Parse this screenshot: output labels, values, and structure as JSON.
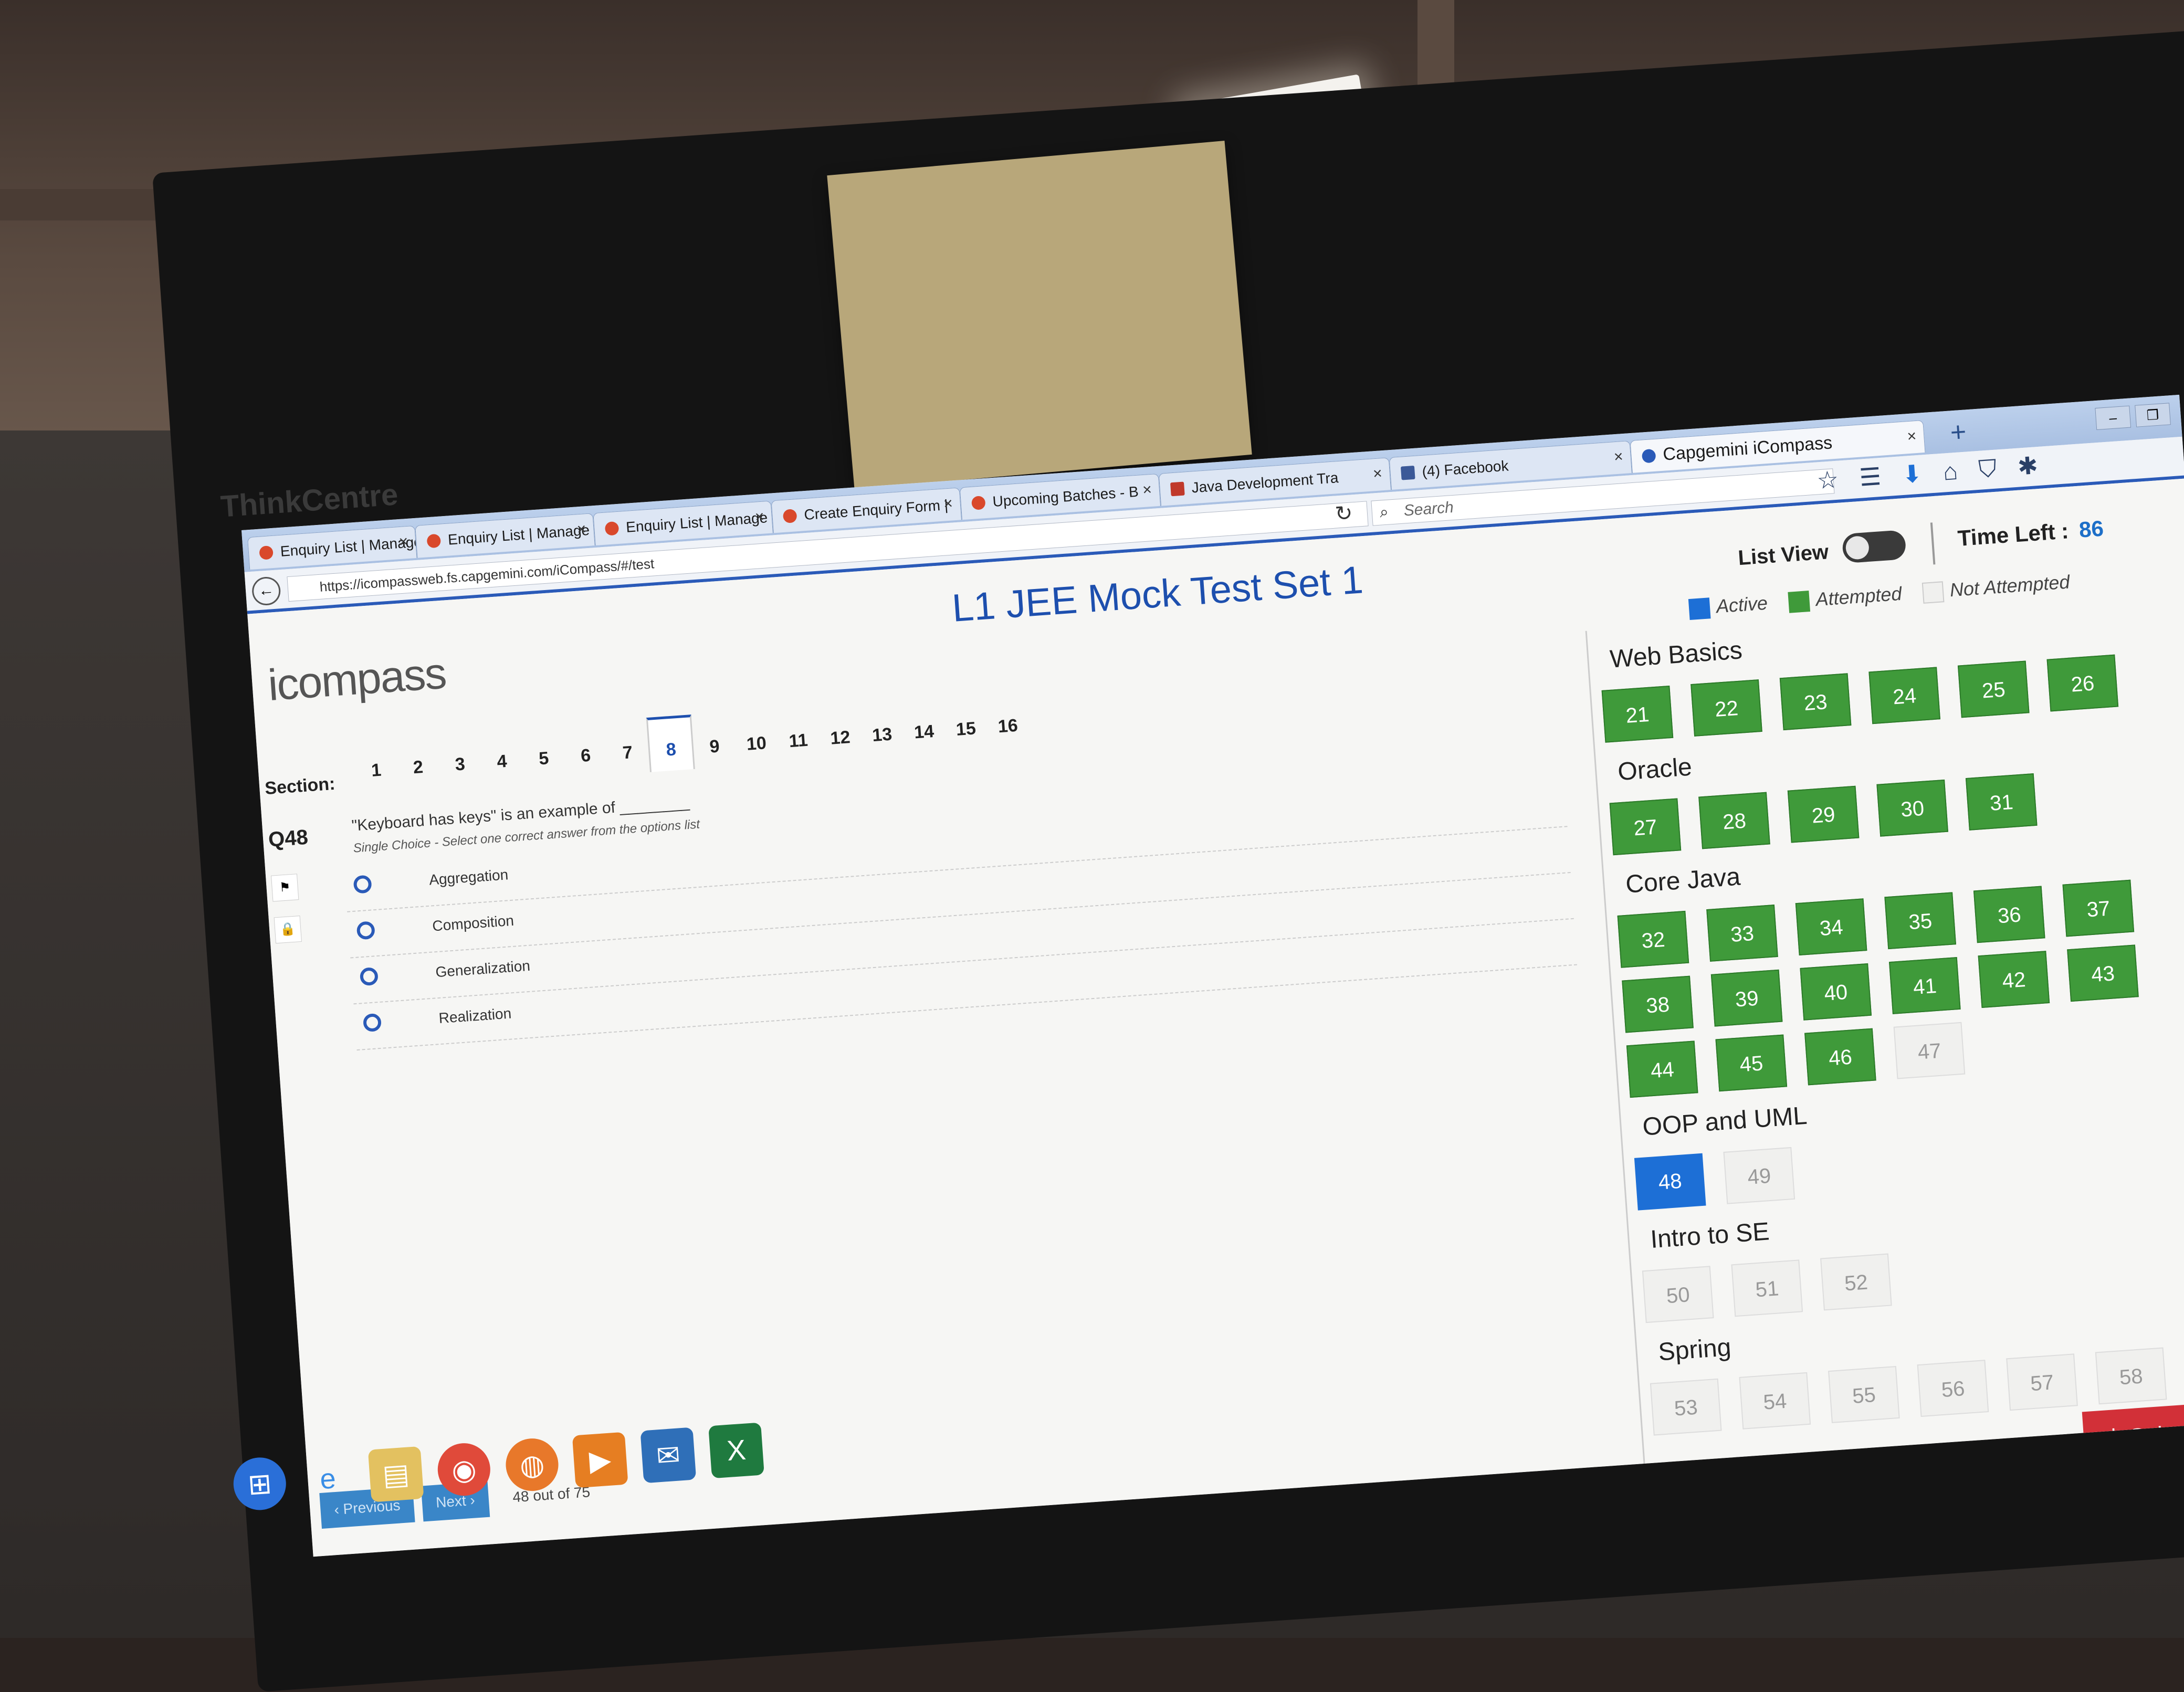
{
  "monitor": {
    "brand": "ThinkCentre"
  },
  "browser": {
    "tabs": [
      {
        "label": "Enquiry List | Manage"
      },
      {
        "label": "Enquiry List | Manage"
      },
      {
        "label": "Enquiry List | Manage"
      },
      {
        "label": "Create Enquiry Form |"
      },
      {
        "label": "Upcoming Batches - B"
      },
      {
        "label": "Java Development Tra"
      },
      {
        "label": "(4) Facebook"
      },
      {
        "label": "Capgemini iCompass"
      }
    ],
    "new_tab": "+",
    "url": "https://icompassweb.fs.capgemini.com/iCompass/#/test",
    "search_placeholder": "Search"
  },
  "page": {
    "logo": "icompass",
    "title": "L1 JEE Mock Test Set 1",
    "list_view_label": "List View",
    "time_left_label": "Time Left :",
    "time_left_value": "86",
    "legend": {
      "active": "Active",
      "attempted": "Attempted",
      "not_attempted": "Not Attempted"
    },
    "section_label": "Section:",
    "sections": [
      "1",
      "2",
      "3",
      "4",
      "5",
      "6",
      "7",
      "8",
      "9",
      "10",
      "11",
      "12",
      "13",
      "14",
      "15",
      "16"
    ],
    "current_section": "8",
    "question": {
      "number": "Q48",
      "text": "\"Keyboard has keys\" is an example of ________",
      "hint": "Single Choice - Select one correct answer from the options list",
      "options": [
        "Aggregation",
        "Composition",
        "Generalization",
        "Realization"
      ]
    },
    "footer": {
      "previous": "‹ Previous",
      "next": "Next ›",
      "count": "48 out of 75"
    },
    "submit": "Submit Asses"
  },
  "palette": [
    {
      "title": "Web Basics",
      "questions": [
        {
          "n": "21",
          "s": "attempted"
        },
        {
          "n": "22",
          "s": "attempted"
        },
        {
          "n": "23",
          "s": "attempted"
        },
        {
          "n": "24",
          "s": "attempted"
        },
        {
          "n": "25",
          "s": "attempted"
        },
        {
          "n": "26",
          "s": "attempted"
        }
      ]
    },
    {
      "title": "Oracle",
      "questions": [
        {
          "n": "27",
          "s": "attempted"
        },
        {
          "n": "28",
          "s": "attempted"
        },
        {
          "n": "29",
          "s": "attempted"
        },
        {
          "n": "30",
          "s": "attempted"
        },
        {
          "n": "31",
          "s": "attempted"
        }
      ]
    },
    {
      "title": "Core Java",
      "questions": [
        {
          "n": "32",
          "s": "attempted"
        },
        {
          "n": "33",
          "s": "attempted"
        },
        {
          "n": "34",
          "s": "attempted"
        },
        {
          "n": "35",
          "s": "attempted"
        },
        {
          "n": "36",
          "s": "attempted"
        },
        {
          "n": "37",
          "s": "attempted"
        },
        {
          "n": "38",
          "s": "attempted"
        },
        {
          "n": "39",
          "s": "attempted"
        },
        {
          "n": "40",
          "s": "attempted"
        },
        {
          "n": "41",
          "s": "attempted"
        },
        {
          "n": "42",
          "s": "attempted"
        },
        {
          "n": "43",
          "s": "attempted"
        },
        {
          "n": "44",
          "s": "attempted"
        },
        {
          "n": "45",
          "s": "attempted"
        },
        {
          "n": "46",
          "s": "attempted"
        },
        {
          "n": "47",
          "s": "not_attempted"
        }
      ]
    },
    {
      "title": "OOP and UML",
      "questions": [
        {
          "n": "48",
          "s": "active"
        },
        {
          "n": "49",
          "s": "not_attempted"
        }
      ]
    },
    {
      "title": "Intro to SE",
      "questions": [
        {
          "n": "50",
          "s": "not_attempted"
        },
        {
          "n": "51",
          "s": "not_attempted"
        },
        {
          "n": "52",
          "s": "not_attempted"
        }
      ]
    },
    {
      "title": "Spring",
      "questions": [
        {
          "n": "53",
          "s": "not_attempted"
        },
        {
          "n": "54",
          "s": "not_attempted"
        },
        {
          "n": "55",
          "s": "not_attempted"
        },
        {
          "n": "56",
          "s": "not_attempted"
        },
        {
          "n": "57",
          "s": "not_attempted"
        },
        {
          "n": "58",
          "s": "not_attempted"
        }
      ]
    }
  ],
  "colors": {
    "active": "#1d6fd6",
    "attempted": "#3f9a3a",
    "not_attempted": "#f0f0ee",
    "title": "#1d4fae",
    "submit": "#d23038"
  },
  "taskbar_icons": [
    "windows-start-icon",
    "ie-icon",
    "file-explorer-icon",
    "chrome-icon",
    "firefox-icon",
    "media-player-icon",
    "outlook-icon",
    "excel-icon"
  ]
}
